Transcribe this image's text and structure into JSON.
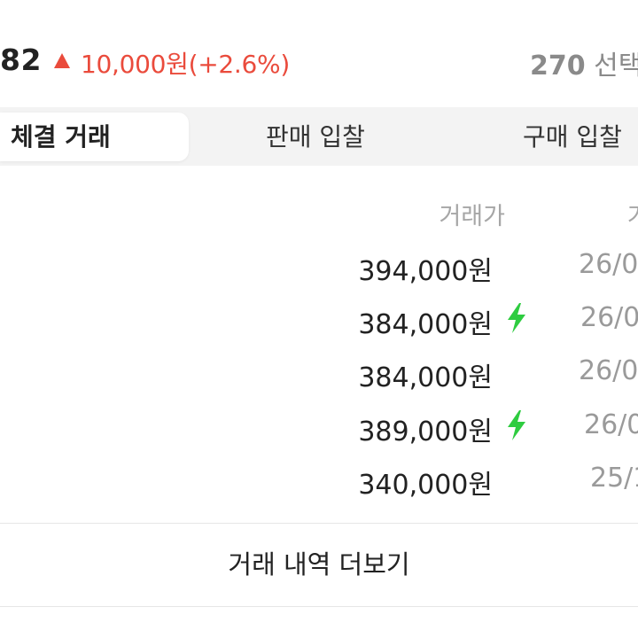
{
  "header": {
    "price": "82",
    "change_text": "10,000원(+2.6%)",
    "right_number": "270",
    "right_label": "선택"
  },
  "tabs": [
    {
      "label": "체결 거래",
      "active": true
    },
    {
      "label": "판매 입찰",
      "active": false
    },
    {
      "label": "구매 입찰",
      "active": false
    }
  ],
  "table": {
    "columns": [
      "거래가",
      "거"
    ],
    "rows": [
      {
        "price": "394,000원",
        "date": "26/0",
        "fast": false
      },
      {
        "price": "384,000원",
        "date": "26/0",
        "fast": true
      },
      {
        "price": "384,000원",
        "date": "26/0",
        "fast": false
      },
      {
        "price": "389,000원",
        "date": "26/0",
        "fast": true
      },
      {
        "price": "340,000원",
        "date": "25/1",
        "fast": false
      }
    ]
  },
  "more_button": "거래 내역 더보기",
  "colors": {
    "up": "#ea4b3c",
    "fast": "#2ecc40",
    "muted": "#a6a6a6"
  },
  "icons": {
    "up": "up-triangle-icon",
    "fast": "lightning-bolt-icon"
  }
}
